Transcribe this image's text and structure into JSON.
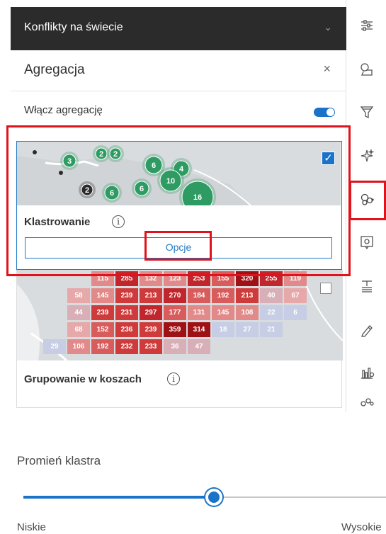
{
  "layer_title": "Konflikty na świecie",
  "aggregation": {
    "title": "Agregacja",
    "close_symbol": "×",
    "enable_label": "Włącz agregację",
    "enabled": true
  },
  "clustering": {
    "label": "Klastrowanie",
    "options_label": "Opcje",
    "checked": true,
    "cluster_counts": [
      "3",
      "2",
      "2",
      "6",
      "4",
      "10",
      "2",
      "6",
      "6",
      "16"
    ]
  },
  "binning": {
    "label": "Grupowanie w koszach",
    "grid_rows": [
      [
        "115",
        "285",
        "132",
        "123",
        "253",
        "155",
        "320",
        "255",
        "119"
      ],
      [
        "58",
        "145",
        "239",
        "213",
        "270",
        "184",
        "192",
        "213",
        "40",
        "67"
      ],
      [
        "44",
        "239",
        "231",
        "297",
        "177",
        "131",
        "145",
        "108",
        "22",
        "6"
      ],
      [
        "68",
        "152",
        "236",
        "239",
        "359",
        "314",
        "18",
        "27",
        "21"
      ],
      [
        "29",
        "106",
        "192",
        "232",
        "233",
        "36",
        "47"
      ]
    ]
  },
  "toolbar": {
    "icons": [
      "properties-icon",
      "styles-icon",
      "filter-icon",
      "effects-icon",
      "aggregation-icon",
      "popups-icon",
      "labels-icon",
      "sketch-icon",
      "charts-icon",
      "more-icon"
    ],
    "active": "aggregation-icon"
  },
  "cluster_radius": {
    "label": "Promień klastra",
    "low_label": "Niskie",
    "high_label": "Wysokie",
    "value_fraction": 0.52
  },
  "colors": {
    "accent": "#1a73c8",
    "highlight": "#e0121b",
    "header_bg": "#2b2b2b",
    "cluster_green": "#2e9b62"
  }
}
